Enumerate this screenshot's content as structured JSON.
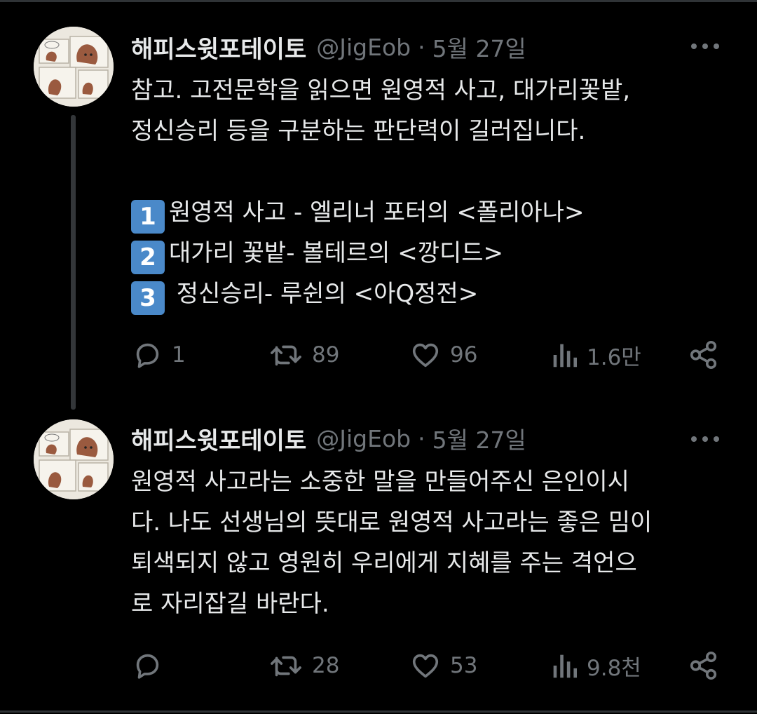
{
  "tweets": [
    {
      "author": {
        "name": "해피스윗포테이토",
        "handle": "@JigEob",
        "date": "5월 27일",
        "separator": "·"
      },
      "body": {
        "line1": "참고. 고전문학을 읽으면 원영적 사고, 대가리꽃밭,",
        "line2": "정신승리 등을 구분하는 판단력이 길러집니다.",
        "list": [
          {
            "key": "1",
            "text": "원영적 사고 - 엘리너 포터의 <폴리아나>"
          },
          {
            "key": "2",
            "text": "대가리 꽃밭- 볼테르의 <깡디드>"
          },
          {
            "key": "3",
            "text": " 정신승리- 루쉰의 <아Q정전>"
          }
        ]
      },
      "stats": {
        "replies": "1",
        "retweets": "89",
        "likes": "96",
        "views": "1.6만"
      }
    },
    {
      "author": {
        "name": "해피스윗포테이토",
        "handle": "@JigEob",
        "date": "5월 27일",
        "separator": "·"
      },
      "body": {
        "lines": [
          "원영적 사고라는 소중한 말을 만들어주신 은인이시",
          "다. 나도 선생님의 뜻대로 원영적 사고라는 좋은 밈이",
          "퇴색되지 않고 영원히 우리에게 지혜를 주는 격언으",
          "로 자리잡길 바란다."
        ]
      },
      "stats": {
        "replies": "",
        "retweets": "28",
        "likes": "53",
        "views": "9.8천"
      }
    }
  ],
  "colors": {
    "background": "#000000",
    "text": "#e7e9ea",
    "muted": "#71767b",
    "divider": "#2f3336",
    "keycap": "#4a89c9"
  },
  "icons": [
    "more-icon",
    "reply-icon",
    "retweet-icon",
    "like-icon",
    "views-icon",
    "share-icon"
  ]
}
